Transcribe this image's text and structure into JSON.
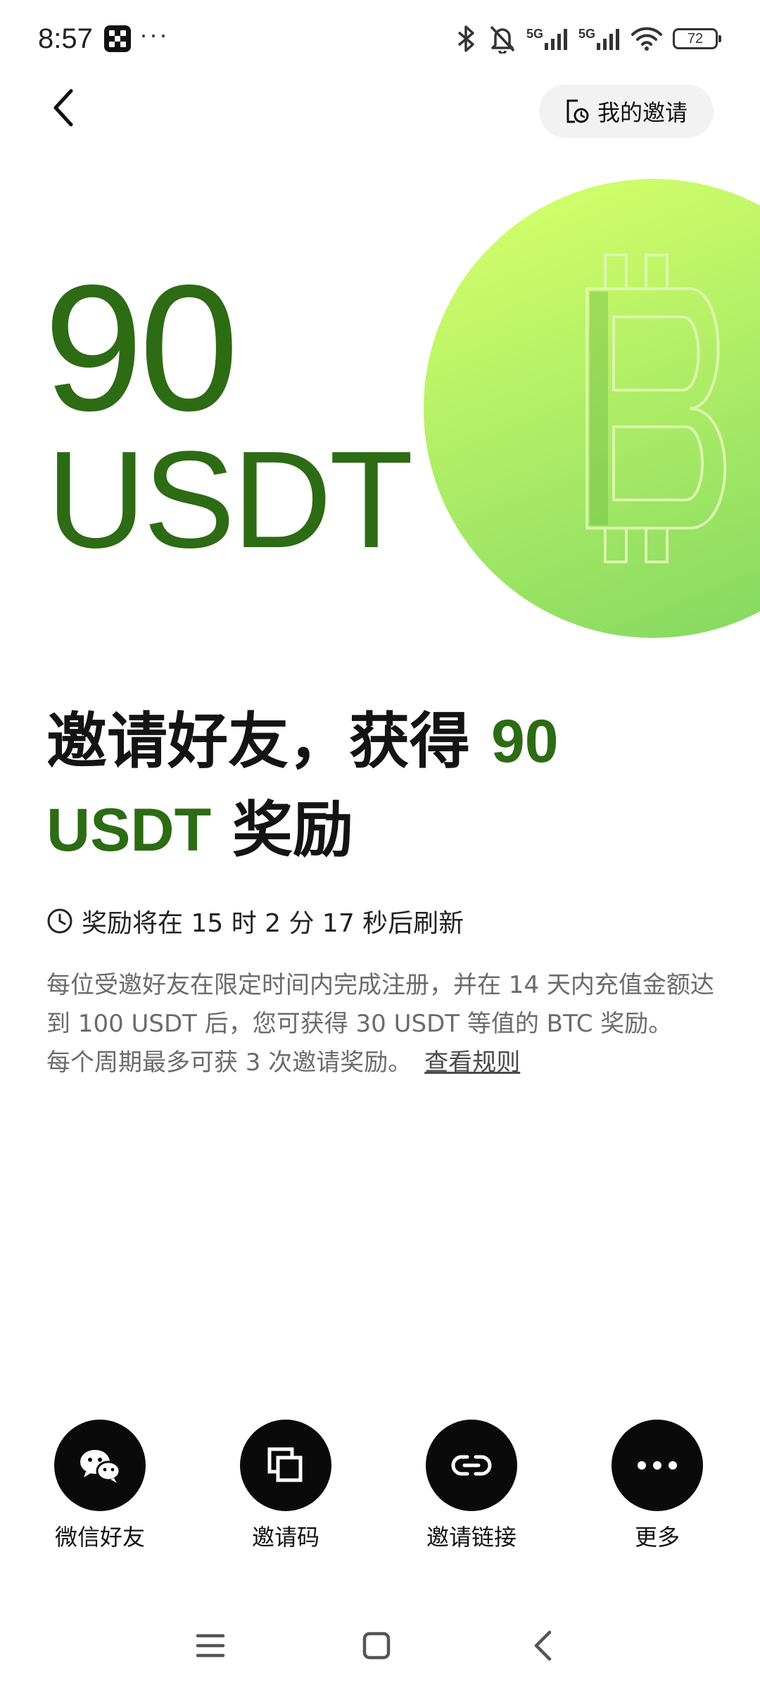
{
  "status_bar": {
    "time": "8:57",
    "more_dots": "···",
    "network_1": "5G",
    "network_2": "5G",
    "battery": "72"
  },
  "header": {
    "my_invites_label": "我的邀请"
  },
  "hero": {
    "amount": "90",
    "unit": "USDT"
  },
  "headline": {
    "part1": "邀请好友，获得 ",
    "accent": "90 USDT",
    "part2": " 奖励"
  },
  "refresh": {
    "text": "奖励将在 15 时 2 分 17 秒后刷新"
  },
  "description": {
    "line1": "每位受邀好友在限定时间内完成注册，并在 14 天内充值金额达到 100 USDT 后，您可获得 30 USDT 等值的 BTC 奖励。",
    "line2": "每个周期最多可获 3 次邀请奖励。",
    "rules_link": "查看规则"
  },
  "share": {
    "items": [
      {
        "label": "微信好友",
        "icon": "wechat-icon"
      },
      {
        "label": "邀请码",
        "icon": "copy-icon"
      },
      {
        "label": "邀请链接",
        "icon": "link-icon"
      },
      {
        "label": "更多",
        "icon": "more-icon"
      }
    ]
  },
  "colors": {
    "accent_green": "#2d6b14",
    "coin_light": "#cdfd6a",
    "coin_dark": "#8fdc5e"
  }
}
